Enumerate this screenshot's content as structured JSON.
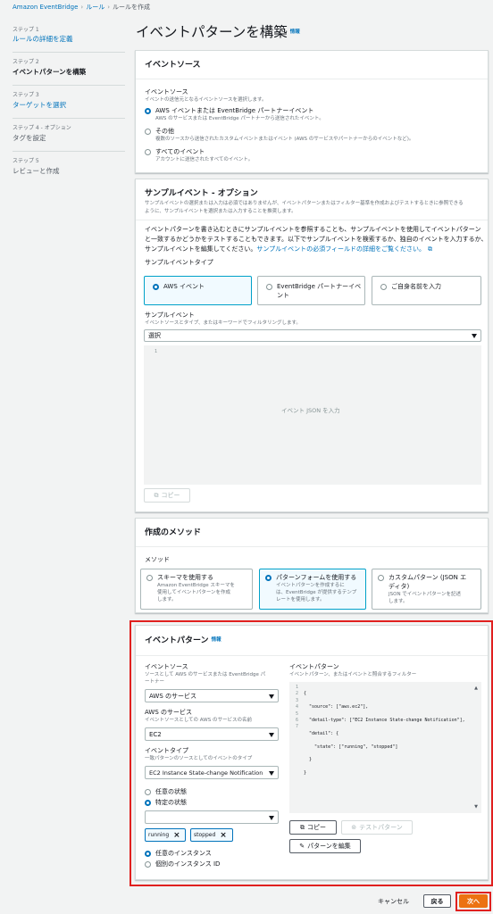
{
  "breadcrumb": {
    "item1": "Amazon EventBridge",
    "item2": "ルール",
    "item3": "ルールを作成"
  },
  "nav": {
    "steps": [
      {
        "step": "ステップ 1",
        "label": "ルールの詳細を定義"
      },
      {
        "step": "ステップ 2",
        "label": "イベントパターンを構築"
      },
      {
        "step": "ステップ 3",
        "label": "ターゲットを選択"
      },
      {
        "step": "ステップ 4 - オプション",
        "label": "タグを設定"
      },
      {
        "step": "ステップ 5",
        "label": "レビューと作成"
      }
    ]
  },
  "page": {
    "title": "イベントパターンを構築",
    "info": "情報"
  },
  "event_source": {
    "heading": "イベントソース",
    "label": "イベントソース",
    "desc": "イベントの送信元となるイベントソースを選択します。",
    "options": [
      {
        "label": "AWS イベントまたは EventBridge パートナーイベント",
        "desc": "AWS のサービスまたは EventBridge パートナーから送信されたイベント。"
      },
      {
        "label": "その他",
        "desc": "複数のソースから送信されたカスタムイベントまたはイベント (AWS のサービスやパートナーからのイベントなど)。"
      },
      {
        "label": "すべてのイベント",
        "desc": "アカウントに送信されたすべてのイベント。"
      }
    ]
  },
  "sample": {
    "heading": "サンプルイベント - オプション",
    "desc1": "サンプルイベントの選択または入力は必須ではありませんが、イベントパターンまたはフィルター基準を作成およびテストするときに参照できる",
    "desc2": "ように、サンプルイベントを選択または入力することを推奨します。",
    "body1": "イベントパターンを書き込むときにサンプルイベントを参照することも、サンプルイベントを使用してイベントパターン",
    "body2": "と一致するかどうかをテストすることもできます。以下でサンプルイベントを検索するか、独自のイベントを入力するか、",
    "body3": "サンプルイベントを編集してください。",
    "body_link": "サンプルイベントの必須フィールドの詳細をご覧ください。",
    "type_label": "サンプルイベントタイプ",
    "type_aws": "AWS イベント",
    "type_partner1": "EventBridge パートナーイベ",
    "type_partner2": "ント",
    "type_custom": "ご自身名前を入力",
    "event_label": "サンプルイベント",
    "event_desc": "イベントソースとタイプ、またはキーワードでフィルタリングします。",
    "select_value": "選択",
    "editor_placeholder": "イベント JSON を入力",
    "line1": "1",
    "copy": "コピー"
  },
  "method": {
    "heading": "作成のメソッド",
    "label": "メソッド",
    "options": [
      {
        "title": "スキーマを使用する",
        "desc": [
          "Amazon EventBridge スキーマを",
          "使用してイベントパターンを作成",
          "します。"
        ]
      },
      {
        "title": "パターンフォームを使用する",
        "desc": [
          "イベントパターンを作成するに",
          "は、EventBridge が提供するテンプ",
          "レートを使用します。"
        ]
      },
      {
        "title": "カスタムパターン (JSON エ",
        "title2": "ディタ)",
        "desc": [
          "JSON でイベントパターンを記述",
          "します。"
        ]
      }
    ]
  },
  "pattern": {
    "heading": "イベントパターン",
    "info": "情報",
    "source_label": "イベントソース",
    "source_desc1": "ソースとして AWS のサービスまたは EventBridge パ",
    "source_desc2": "ートナー",
    "source_value": "AWS のサービス",
    "service_label": "AWS のサービス",
    "service_desc": "イベントソースとしての AWS のサービスの名前",
    "service_value": "EC2",
    "type_label": "イベントタイプ",
    "type_desc": "一致パターンのソースとしてのイベントのタイプ",
    "type_value": "EC2 Instance State-change Notification",
    "state_any": "任意の状態",
    "state_specific": "特定の状態",
    "tag_running": "running",
    "tag_stopped": "stopped",
    "inst_any": "任意のインスタンス",
    "inst_specific": "個別のインスタンス ID",
    "json_label": "イベントパターン",
    "json_desc": "イベントパターン、またはイベントと照合するフィルター",
    "json_lines": [
      "{",
      "  \"source\": [\"aws.ec2\"],",
      "  \"detail-type\": [\"EC2 Instance State-change Notification\"],",
      "  \"detail\": {",
      "    \"state\": [\"running\", \"stopped\"]",
      "  }",
      "}"
    ],
    "line_numbers": [
      "1",
      "2",
      "3",
      "4",
      "5",
      "6",
      "7"
    ],
    "copy": "コピー",
    "test": "テストパターン",
    "edit": "パターンを編集"
  },
  "footer": {
    "cancel": "キャンセル",
    "back": "戻る",
    "next": "次へ"
  },
  "colors": {
    "accent": "#0073bb",
    "primary": "#ec7211",
    "highlight": "#e0201f"
  }
}
